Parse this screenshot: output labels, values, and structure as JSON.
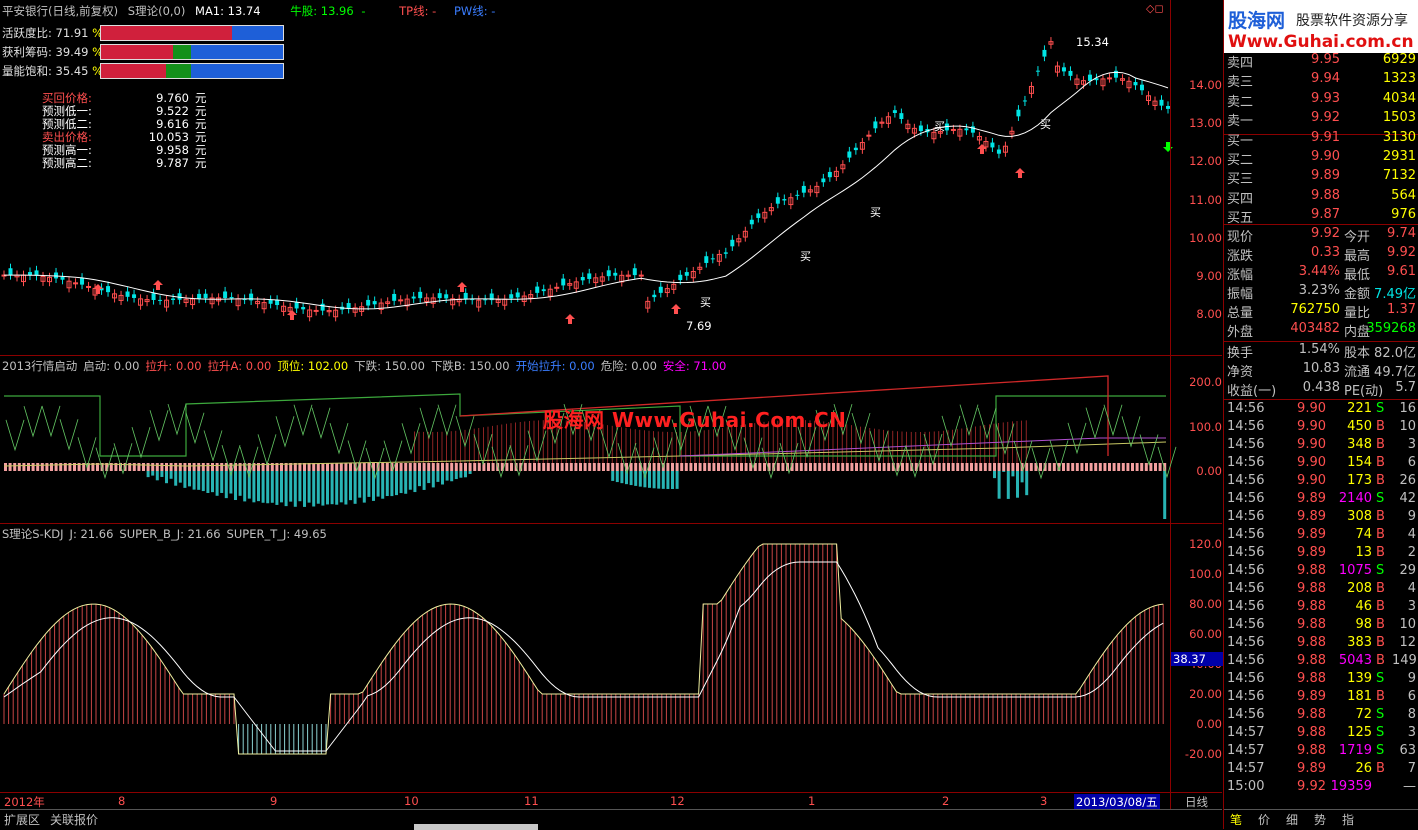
{
  "header": {
    "stock": "平安银行(日线,前复权)",
    "formula": "S理论(0,0)",
    "ma": "MA1: 13.74",
    "bull": "牛股: 13.96",
    "bull_tail": "-",
    "tp": "TP线: -",
    "pw": "PW线: -"
  },
  "indicators": [
    {
      "label": "活跃度比:",
      "value": "71.91",
      "pct": "%"
    },
    {
      "label": "获利筹码:",
      "value": "39.49",
      "pct": "%"
    },
    {
      "label": "量能饱和:",
      "value": "35.45",
      "pct": "%"
    }
  ],
  "predictions": [
    {
      "label": "买回价格:",
      "value": "9.760",
      "unit": "元",
      "color": "#ff4f4f"
    },
    {
      "label": "预测低一:",
      "value": "9.522",
      "unit": "元",
      "color": "#ffffff"
    },
    {
      "label": "预测低二:",
      "value": "9.616",
      "unit": "元",
      "color": "#ffffff"
    },
    {
      "label": "卖出价格:",
      "value": "10.053",
      "unit": "元",
      "color": "#ff4f4f"
    },
    {
      "label": "预测高一:",
      "value": "9.958",
      "unit": "元",
      "color": "#ffffff"
    },
    {
      "label": "预测高二:",
      "value": "9.787",
      "unit": "元",
      "color": "#ffffff"
    }
  ],
  "main_yaxis": [
    "14.00",
    "13.00",
    "12.00",
    "11.00",
    "10.00",
    "9.00",
    "8.00"
  ],
  "main_annotations": {
    "high": "15.34",
    "low": "7.69",
    "buy": "买"
  },
  "ind2_header": [
    {
      "t": "2013行情启动",
      "c": "#c0c0c0"
    },
    {
      "t": "启动: 0.00",
      "c": "#c0c0c0"
    },
    {
      "t": "拉升: 0.00",
      "c": "#ff4f4f"
    },
    {
      "t": "拉升A: 0.00",
      "c": "#ff4f4f"
    },
    {
      "t": "顶位: 102.00",
      "c": "#ffff00"
    },
    {
      "t": "下跌: 150.00",
      "c": "#c0c0c0"
    },
    {
      "t": "下跌B: 150.00",
      "c": "#c0c0c0"
    },
    {
      "t": "开始拉升: 0.00",
      "c": "#3a7dff"
    },
    {
      "t": "危险: 0.00",
      "c": "#c0c0c0"
    },
    {
      "t": "安全: 71.00",
      "c": "#ff00ff"
    }
  ],
  "ind2_yaxis": [
    "200.0",
    "100.0",
    "0.00"
  ],
  "watermark": "股海网 Www.Guhai.Com.CN",
  "ind3_header": [
    {
      "t": "S理论S-KDJ",
      "c": "#c0c0c0"
    },
    {
      "t": "J: 21.66",
      "c": "#c0c0c0"
    },
    {
      "t": "SUPER_B_J: 21.66",
      "c": "#c0c0c0"
    },
    {
      "t": "SUPER_T_J: 49.65",
      "c": "#c0c0c0"
    }
  ],
  "ind3_yaxis": [
    "120.0",
    "100.0",
    "80.00",
    "60.00",
    "40.00",
    "20.00",
    "0.00",
    "-20.00"
  ],
  "ind3_marker": "38.37",
  "xaxis": {
    "labels": [
      "2012年",
      "8",
      "9",
      "10",
      "11",
      "12",
      "1",
      "2",
      "3"
    ],
    "current_date": "2013/03/08/五",
    "period": "日线"
  },
  "bottom_tabs": [
    "扩展区",
    "关联报价"
  ],
  "logo": {
    "name": "股海网",
    "slogan": "股票软件资源分享",
    "url": "Www.Guhai.com.cn"
  },
  "order_book": {
    "sell": [
      {
        "label": "卖四",
        "price": "9.95",
        "vol": "6929"
      },
      {
        "label": "卖三",
        "price": "9.94",
        "vol": "1323"
      },
      {
        "label": "卖二",
        "price": "9.93",
        "vol": "4034"
      },
      {
        "label": "卖一",
        "price": "9.92",
        "vol": "1503"
      }
    ],
    "buy": [
      {
        "label": "买一",
        "price": "9.91",
        "vol": "3130"
      },
      {
        "label": "买二",
        "price": "9.90",
        "vol": "2931"
      },
      {
        "label": "买三",
        "price": "9.89",
        "vol": "7132"
      },
      {
        "label": "买四",
        "price": "9.88",
        "vol": "564"
      },
      {
        "label": "买五",
        "price": "9.87",
        "vol": "976"
      }
    ]
  },
  "stats": [
    {
      "l1": "现价",
      "v1": "9.92",
      "c1": "#ff4f4f",
      "l2": "今开",
      "v2": "9.74",
      "c2": "#ff4f4f"
    },
    {
      "l1": "涨跌",
      "v1": "0.33",
      "c1": "#ff4f4f",
      "l2": "最高",
      "v2": "9.92",
      "c2": "#ff4f4f"
    },
    {
      "l1": "涨幅",
      "v1": "3.44%",
      "c1": "#ff4f4f",
      "l2": "最低",
      "v2": "9.61",
      "c2": "#ff4f4f"
    },
    {
      "l1": "振幅",
      "v1": "3.23%",
      "c1": "#c0c0c0",
      "l2": "金额",
      "v2": "7.49亿",
      "c2": "#00e5e5"
    },
    {
      "l1": "总量",
      "v1": "762750",
      "c1": "#ffff00",
      "l2": "量比",
      "v2": "1.37",
      "c2": "#ff4f4f"
    },
    {
      "l1": "外盘",
      "v1": "403482",
      "c1": "#ff4f4f",
      "l2": "内盘",
      "v2": "359268",
      "c2": "#00ff00"
    },
    {
      "l1": "换手",
      "v1": "1.54%",
      "c1": "#c0c0c0",
      "l2": "股本",
      "v2": "82.0亿",
      "c2": "#c0c0c0"
    },
    {
      "l1": "净资",
      "v1": "10.83",
      "c1": "#c0c0c0",
      "l2": "流通",
      "v2": "49.7亿",
      "c2": "#c0c0c0"
    },
    {
      "l1": "收益(一)",
      "v1": "0.438",
      "c1": "#c0c0c0",
      "l2": "PE(动)",
      "v2": "5.7",
      "c2": "#c0c0c0"
    }
  ],
  "ticks": [
    {
      "t": "14:56",
      "p": "9.90",
      "v": "221",
      "s": "S",
      "n": "16",
      "vc": "#ffff00"
    },
    {
      "t": "14:56",
      "p": "9.90",
      "v": "450",
      "s": "B",
      "n": "10",
      "vc": "#ffff00"
    },
    {
      "t": "14:56",
      "p": "9.90",
      "v": "348",
      "s": "B",
      "n": "3",
      "vc": "#ffff00"
    },
    {
      "t": "14:56",
      "p": "9.90",
      "v": "154",
      "s": "B",
      "n": "6",
      "vc": "#ffff00"
    },
    {
      "t": "14:56",
      "p": "9.90",
      "v": "173",
      "s": "B",
      "n": "26",
      "vc": "#ffff00"
    },
    {
      "t": "14:56",
      "p": "9.89",
      "v": "2140",
      "s": "S",
      "n": "42",
      "vc": "#ff00ff"
    },
    {
      "t": "14:56",
      "p": "9.89",
      "v": "308",
      "s": "B",
      "n": "9",
      "vc": "#ffff00"
    },
    {
      "t": "14:56",
      "p": "9.89",
      "v": "74",
      "s": "B",
      "n": "4",
      "vc": "#ffff00"
    },
    {
      "t": "14:56",
      "p": "9.89",
      "v": "13",
      "s": "B",
      "n": "2",
      "vc": "#ffff00"
    },
    {
      "t": "14:56",
      "p": "9.88",
      "v": "1075",
      "s": "S",
      "n": "29",
      "vc": "#ff00ff"
    },
    {
      "t": "14:56",
      "p": "9.88",
      "v": "208",
      "s": "B",
      "n": "4",
      "vc": "#ffff00"
    },
    {
      "t": "14:56",
      "p": "9.88",
      "v": "46",
      "s": "B",
      "n": "3",
      "vc": "#ffff00"
    },
    {
      "t": "14:56",
      "p": "9.88",
      "v": "98",
      "s": "B",
      "n": "10",
      "vc": "#ffff00"
    },
    {
      "t": "14:56",
      "p": "9.88",
      "v": "383",
      "s": "B",
      "n": "12",
      "vc": "#ffff00"
    },
    {
      "t": "14:56",
      "p": "9.88",
      "v": "5043",
      "s": "B",
      "n": "149",
      "vc": "#ff00ff"
    },
    {
      "t": "14:56",
      "p": "9.88",
      "v": "139",
      "s": "S",
      "n": "9",
      "vc": "#ffff00"
    },
    {
      "t": "14:56",
      "p": "9.89",
      "v": "181",
      "s": "B",
      "n": "6",
      "vc": "#ffff00"
    },
    {
      "t": "14:56",
      "p": "9.88",
      "v": "72",
      "s": "S",
      "n": "8",
      "vc": "#ffff00"
    },
    {
      "t": "14:57",
      "p": "9.88",
      "v": "125",
      "s": "S",
      "n": "3",
      "vc": "#ffff00"
    },
    {
      "t": "14:57",
      "p": "9.88",
      "v": "1719",
      "s": "S",
      "n": "63",
      "vc": "#ff00ff"
    },
    {
      "t": "14:57",
      "p": "9.89",
      "v": "26",
      "s": "B",
      "n": "7",
      "vc": "#ffff00"
    },
    {
      "t": "15:00",
      "p": "9.92",
      "v": "19359",
      "s": "",
      "n": "—",
      "vc": "#ff00ff"
    }
  ],
  "bottom_right_tabs": [
    "笔",
    "价",
    "细",
    "势",
    "指"
  ],
  "colors": {
    "up": "#ff4f4f",
    "down": "#00e5e5",
    "border": "#8b0000"
  }
}
